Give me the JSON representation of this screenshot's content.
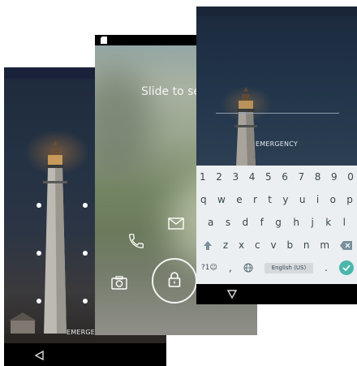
{
  "phone1": {
    "emergency_label": "EMERGENCY",
    "nav_back_icon": "back-triangle-icon"
  },
  "phone2": {
    "slide_text": "Slide to sele",
    "shortcuts": [
      "phone-icon",
      "email-icon",
      "camera-icon",
      "lock-icon"
    ]
  },
  "phone3": {
    "emergency_label": "EMERGENCY",
    "keyboard": {
      "row_numbers": [
        "1",
        "2",
        "3",
        "4",
        "5",
        "6",
        "7",
        "8",
        "9",
        "0"
      ],
      "row_top": [
        "q",
        "w",
        "e",
        "r",
        "t",
        "y",
        "u",
        "i",
        "o",
        "p"
      ],
      "row_mid": [
        "a",
        "s",
        "d",
        "f",
        "g",
        "h",
        "j",
        "k",
        "l"
      ],
      "row_bottom": [
        "z",
        "x",
        "c",
        "v",
        "b",
        "n",
        "m"
      ],
      "symbols_key": "?1☺",
      "comma_key": ",",
      "period_key": ".",
      "space_label": "English (US)"
    },
    "nav_back_icon": "back-triangle-icon"
  },
  "colors": {
    "accent_teal": "#4db6ac",
    "keyboard_bg": "#eceff1",
    "night_sky": "#1d2d40"
  }
}
